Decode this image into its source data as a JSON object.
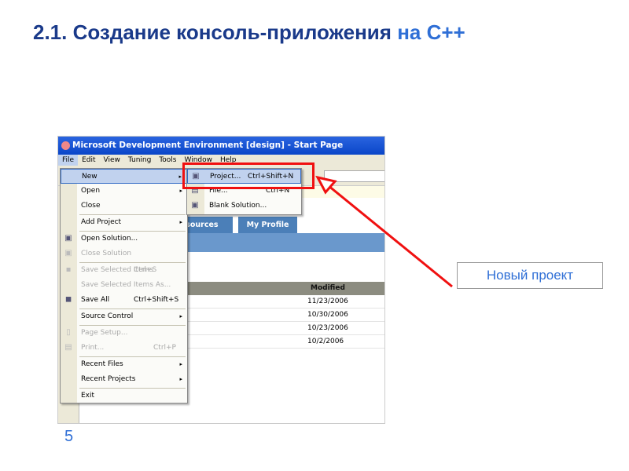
{
  "slide": {
    "title_main": "2.1.  Создание консоль-приложения",
    "title_accent": " на С++",
    "page_number": "5",
    "callout": "Новый проект"
  },
  "window": {
    "title": "Microsoft Development Environment [design] - Start Page",
    "menubar": [
      "File",
      "Edit",
      "View",
      "Tuning",
      "Tools",
      "Window",
      "Help"
    ],
    "tabs": [
      "Resources",
      "My Profile"
    ],
    "table": {
      "header": "Modified",
      "rows": [
        "11/23/2006",
        "10/30/2006",
        "10/23/2006",
        "10/2/2006"
      ]
    }
  },
  "file_menu": [
    {
      "label": "New",
      "arrow": "▸"
    },
    {
      "label": "Open",
      "arrow": "▸"
    },
    {
      "label": "Close"
    },
    {
      "label": "Add Project",
      "arrow": "▸"
    },
    {
      "label": "Open Solution..."
    },
    {
      "label": "Close Solution"
    },
    {
      "label": "Save Selected Items",
      "shortcut": "Ctrl+S"
    },
    {
      "label": "Save Selected Items As..."
    },
    {
      "label": "Save All",
      "shortcut": "Ctrl+Shift+S"
    },
    {
      "label": "Source Control",
      "arrow": "▸"
    },
    {
      "label": "Page Setup..."
    },
    {
      "label": "Print...",
      "shortcut": "Ctrl+P"
    },
    {
      "label": "Recent Files",
      "arrow": "▸"
    },
    {
      "label": "Recent Projects",
      "arrow": "▸"
    },
    {
      "label": "Exit"
    }
  ],
  "new_submenu": [
    {
      "label": "Project...",
      "shortcut": "Ctrl+Shift+N"
    },
    {
      "label": "File...",
      "shortcut": "Ctrl+N"
    },
    {
      "label": "Blank Solution..."
    }
  ],
  "colors": {
    "highlight": "#f01010",
    "title": "#1a3a8a",
    "accent": "#2f6fd6"
  }
}
